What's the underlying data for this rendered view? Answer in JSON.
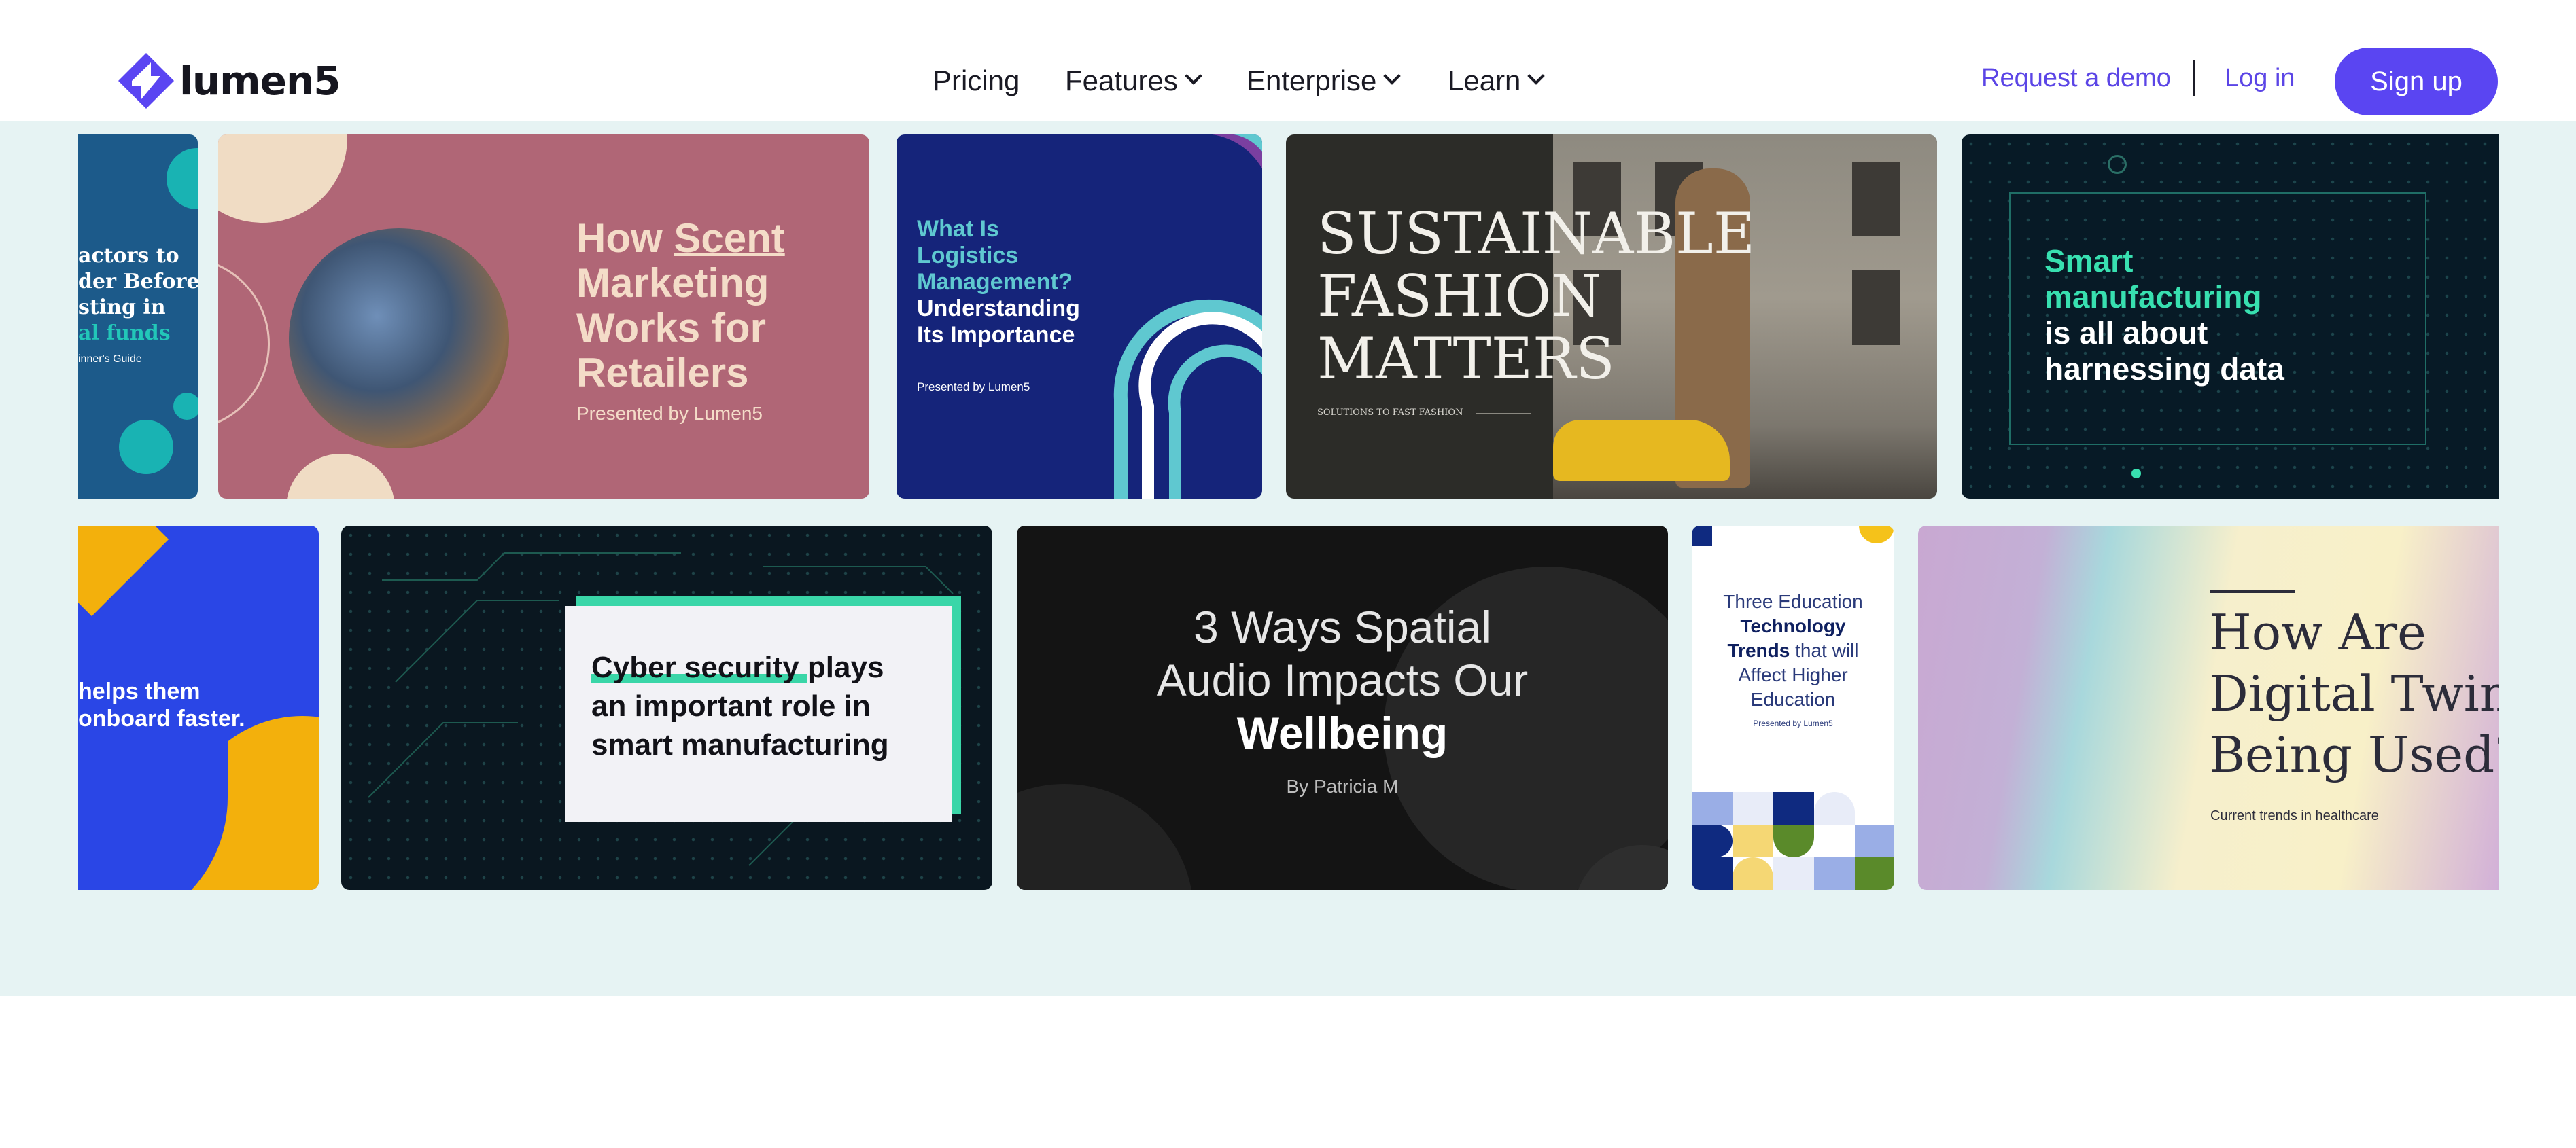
{
  "brand": {
    "name": "lumen5",
    "accent": "#5a45f2"
  },
  "nav": {
    "pricing": "Pricing",
    "features": "Features",
    "enterprise": "Enterprise",
    "learn": "Learn"
  },
  "header_actions": {
    "request_demo": "Request a demo",
    "separator": "|",
    "login": "Log in",
    "signup": "Sign up"
  },
  "gallery": {
    "row1": [
      {
        "line1": "actors to",
        "line2": "der Before",
        "line3": "sting in",
        "line4": "al funds",
        "line5": "inner's Guide"
      },
      {
        "line1a": "How ",
        "line1b": "Scent",
        "line2": "Marketing",
        "line3": "Works for",
        "line4": "Retailers",
        "sub": "Presented by Lumen5"
      },
      {
        "line1": "What Is",
        "line2": "Logistics",
        "line3": "Management?",
        "line4": "Understanding",
        "line5": "Its Importance",
        "sub": "Presented by Lumen5"
      },
      {
        "line1": "SUSTAINABLE",
        "line2": "FASHION",
        "line3": "MATTERS",
        "sub": "SOLUTIONS TO FAST FASHION"
      },
      {
        "line1": "Smart",
        "line2": "manufacturing",
        "line3": "is all about",
        "line4": "harnessing data"
      }
    ],
    "row2": [
      {
        "line1": "helps them",
        "line2": "onboard faster."
      },
      {
        "line1a": "Cyber security",
        "line1b": " plays",
        "line2": "an important role in",
        "line3": "smart manufacturing"
      },
      {
        "line1": "3 Ways Spatial",
        "line2": "Audio Impacts Our",
        "line3": "Wellbeing",
        "sub": "By Patricia M"
      },
      {
        "line1": "Three Education",
        "line2": "Technology",
        "line3a": "Trends",
        "line3b": " that will",
        "line4": "Affect Higher",
        "line5": "Education",
        "sub": "Presented by Lumen5"
      },
      {
        "line1": "How Are",
        "line2": "Digital Twins",
        "line3": "Being Used?",
        "sub": "Current trends in healthcare"
      }
    ]
  }
}
